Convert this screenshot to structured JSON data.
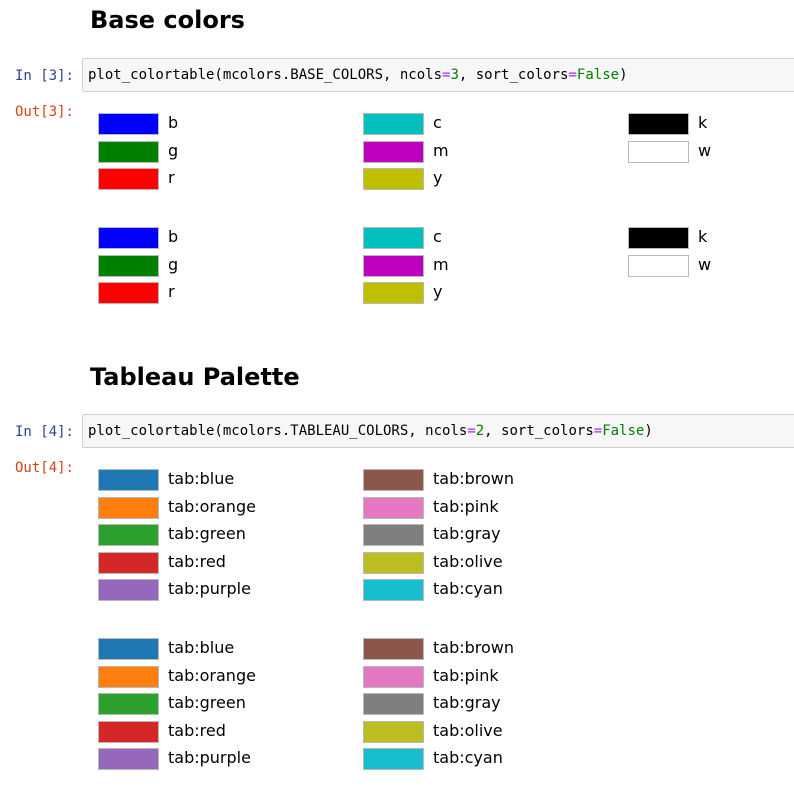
{
  "sections": [
    {
      "heading": "Base colors",
      "in_prompt": "In [3]:",
      "code": {
        "func": "plot_colortable(mcolors.BASE_COLORS, ncols",
        "eq1": "=",
        "num": "3",
        "mid": ", sort_colors",
        "eq2": "=",
        "kw": "False",
        "end": ")"
      },
      "out_prompt": "Out[3]:",
      "outputs": [
        {
          "columns": [
            [
              {
                "name": "b",
                "color": "#0000ff"
              },
              {
                "name": "g",
                "color": "#008000"
              },
              {
                "name": "r",
                "color": "#ff0000"
              }
            ],
            [
              {
                "name": "c",
                "color": "#00bfbf"
              },
              {
                "name": "m",
                "color": "#bf00bf"
              },
              {
                "name": "y",
                "color": "#bfbf00"
              }
            ],
            [
              {
                "name": "k",
                "color": "#000000"
              },
              {
                "name": "w",
                "color": "#ffffff"
              }
            ]
          ]
        },
        {
          "columns": [
            [
              {
                "name": "b",
                "color": "#0000ff"
              },
              {
                "name": "g",
                "color": "#008000"
              },
              {
                "name": "r",
                "color": "#ff0000"
              }
            ],
            [
              {
                "name": "c",
                "color": "#00bfbf"
              },
              {
                "name": "m",
                "color": "#bf00bf"
              },
              {
                "name": "y",
                "color": "#bfbf00"
              }
            ],
            [
              {
                "name": "k",
                "color": "#000000"
              },
              {
                "name": "w",
                "color": "#ffffff"
              }
            ]
          ]
        }
      ]
    },
    {
      "heading": "Tableau Palette",
      "in_prompt": "In [4]:",
      "code": {
        "func": "plot_colortable(mcolors.TABLEAU_COLORS, ncols",
        "eq1": "=",
        "num": "2",
        "mid": ", sort_colors",
        "eq2": "=",
        "kw": "False",
        "end": ")"
      },
      "out_prompt": "Out[4]:",
      "outputs": [
        {
          "columns": [
            [
              {
                "name": "tab:blue",
                "color": "#1f77b4"
              },
              {
                "name": "tab:orange",
                "color": "#ff7f0e"
              },
              {
                "name": "tab:green",
                "color": "#2ca02c"
              },
              {
                "name": "tab:red",
                "color": "#d62728"
              },
              {
                "name": "tab:purple",
                "color": "#9467bd"
              }
            ],
            [
              {
                "name": "tab:brown",
                "color": "#8c564b"
              },
              {
                "name": "tab:pink",
                "color": "#e377c2"
              },
              {
                "name": "tab:gray",
                "color": "#7f7f7f"
              },
              {
                "name": "tab:olive",
                "color": "#bcbd22"
              },
              {
                "name": "tab:cyan",
                "color": "#17becf"
              }
            ]
          ]
        },
        {
          "columns": [
            [
              {
                "name": "tab:blue",
                "color": "#1f77b4"
              },
              {
                "name": "tab:orange",
                "color": "#ff7f0e"
              },
              {
                "name": "tab:green",
                "color": "#2ca02c"
              },
              {
                "name": "tab:red",
                "color": "#d62728"
              },
              {
                "name": "tab:purple",
                "color": "#9467bd"
              }
            ],
            [
              {
                "name": "tab:brown",
                "color": "#8c564b"
              },
              {
                "name": "tab:pink",
                "color": "#e377c2"
              },
              {
                "name": "tab:gray",
                "color": "#7f7f7f"
              },
              {
                "name": "tab:olive",
                "color": "#bcbd22"
              },
              {
                "name": "tab:cyan",
                "color": "#17becf"
              }
            ]
          ]
        }
      ]
    }
  ]
}
